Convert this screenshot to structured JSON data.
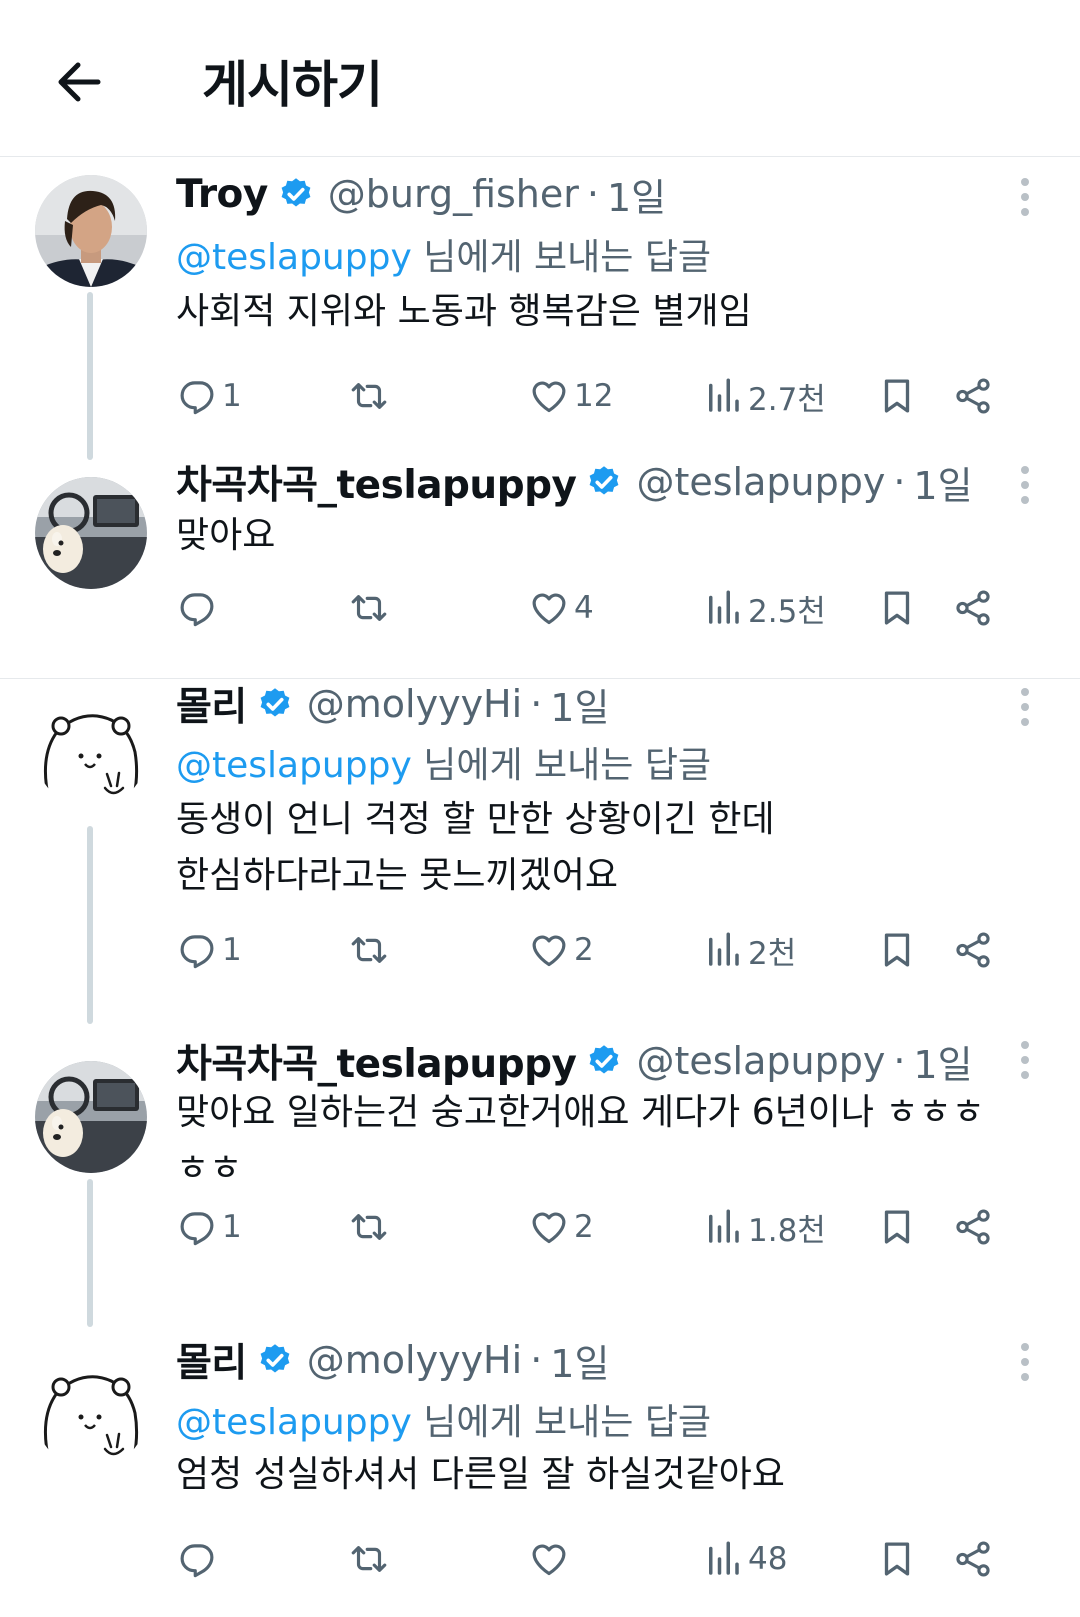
{
  "header": {
    "back_icon": "arrow-left-icon",
    "title": "게시하기"
  },
  "colors": {
    "accent": "#1d9bf0",
    "muted": "#536471",
    "text": "#0f1419",
    "thread_line": "#cfd9de"
  },
  "tweets": [
    {
      "name": "Troy",
      "handle": "@burg_fisher",
      "dot": "·",
      "time": "1일",
      "reply_to": {
        "mention": "@teslapuppy",
        "suffix": " 님에게 보내는 답글"
      },
      "text": "사회적 지위와 노동과 행복감은 별개임",
      "stats": {
        "replies": "1",
        "reposts": "",
        "likes": "12",
        "views": "2.7천"
      }
    },
    {
      "name": "차곡차곡_teslapuppy",
      "handle": "@teslapuppy",
      "dot": "·",
      "time": "1일",
      "text": "맞아요",
      "stats": {
        "replies": "",
        "reposts": "",
        "likes": "4",
        "views": "2.5천"
      }
    },
    {
      "name": "몰리",
      "handle": "@molyyyHi",
      "dot": "·",
      "time": "1일",
      "reply_to": {
        "mention": "@teslapuppy",
        "suffix": " 님에게 보내는 답글"
      },
      "text": "동생이 언니 걱정 할 만한 상황이긴 한데\n한심하다라고는 못느끼겠어요",
      "stats": {
        "replies": "1",
        "reposts": "",
        "likes": "2",
        "views": "2천"
      }
    },
    {
      "name": "차곡차곡_teslapuppy",
      "handle": "@teslapuppy",
      "dot": "·",
      "time": "1일",
      "text": "맞아요 일하는건 숭고한거애요 게다가 6년이나 ㅎㅎㅎ\nㅎㅎ",
      "stats": {
        "replies": "1",
        "reposts": "",
        "likes": "2",
        "views": "1.8천"
      }
    },
    {
      "name": "몰리",
      "handle": "@molyyyHi",
      "dot": "·",
      "time": "1일",
      "reply_to": {
        "mention": "@teslapuppy",
        "suffix": " 님에게 보내는 답글"
      },
      "text": "엄청 성실하셔서 다른일 잘 하실것같아요",
      "stats": {
        "replies": "",
        "reposts": "",
        "likes": "",
        "views": "48"
      }
    }
  ]
}
